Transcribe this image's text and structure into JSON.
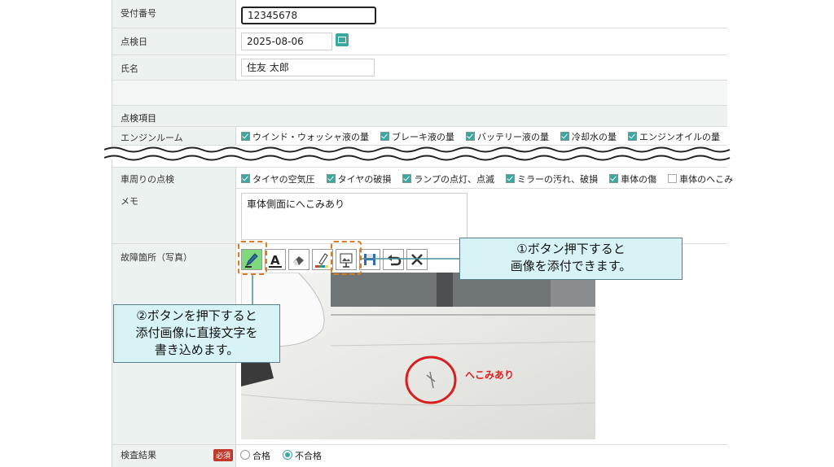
{
  "form": {
    "reception_no": {
      "label": "受付番号",
      "value": "12345678"
    },
    "inspection_date": {
      "label": "点検日",
      "value": "2025-08-06"
    },
    "name": {
      "label": "氏名",
      "value": "住友 太郎"
    },
    "section_title": "点検項目",
    "engine_room": {
      "label": "エンジンルーム",
      "items": [
        {
          "label": "ウインド・ウォッシャ液の量",
          "checked": true
        },
        {
          "label": "ブレーキ液の量",
          "checked": true
        },
        {
          "label": "バッテリー液の量",
          "checked": true
        },
        {
          "label": "冷却水の量",
          "checked": true
        },
        {
          "label": "エンジンオイルの量",
          "checked": true
        }
      ]
    },
    "vehicle_around": {
      "label": "車周りの点検",
      "items": [
        {
          "label": "タイヤの空気圧",
          "checked": true
        },
        {
          "label": "タイヤの破損",
          "checked": true
        },
        {
          "label": "ランプの点灯、点滅",
          "checked": true
        },
        {
          "label": "ミラーの汚れ、破損",
          "checked": true
        },
        {
          "label": "車体の傷",
          "checked": true
        },
        {
          "label": "車体のへこみ",
          "checked": false
        }
      ]
    },
    "memo": {
      "label": "メモ",
      "value": "車体側面にへこみあり"
    },
    "damage_photo": {
      "label": "故障箇所（写真）",
      "annotation": "へこみあり"
    },
    "result": {
      "label": "検査結果",
      "required_badge": "必須",
      "options": [
        {
          "label": "合格",
          "selected": false
        },
        {
          "label": "不合格",
          "selected": true
        }
      ]
    }
  },
  "toolbar": {
    "icons": [
      "pen-icon",
      "text-icon",
      "eraser-icon",
      "color-palette-icon",
      "attach-image-icon",
      "save-icon",
      "undo-icon",
      "close-icon"
    ]
  },
  "callouts": {
    "one_line1": "①ボタン押下すると",
    "one_line2": "画像を添付できます。",
    "two_line1": "②ボタンを押下すると",
    "two_line2": "添付画像に直接文字を",
    "two_line3": "書き込めます。"
  },
  "colors": {
    "accent": "#3aa7a0",
    "highlight": "#e07b1a",
    "callout_bg": "#d8f3f6",
    "required": "#c0392b"
  }
}
